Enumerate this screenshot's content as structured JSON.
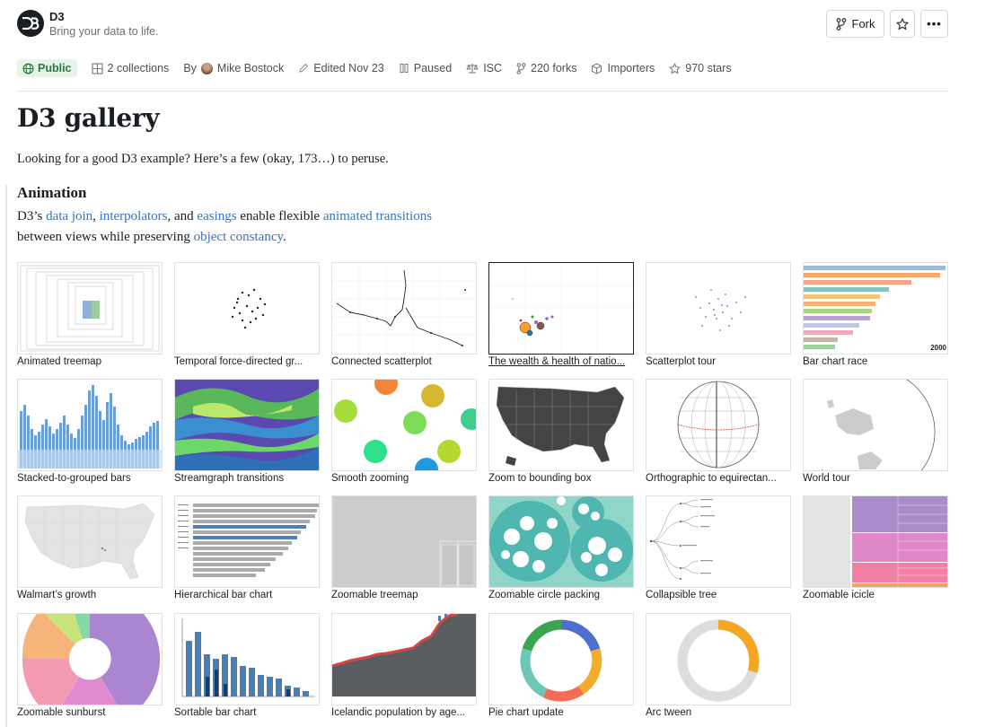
{
  "header": {
    "owner": "D3",
    "tagline": "Bring your data to life.",
    "fork_label": "Fork",
    "more_label": "•••"
  },
  "meta": {
    "visibility": "Public",
    "collections": "2 collections",
    "by_label": "By",
    "author": "Mike Bostock",
    "edited": "Edited Nov 23",
    "status": "Paused",
    "license": "ISC",
    "forks": "220 forks",
    "importers": "Importers",
    "stars": "970 stars"
  },
  "page": {
    "title": "D3 gallery",
    "intro": "Looking for a good D3 example? Here’s a few (okay, 173…) to peruse."
  },
  "section": {
    "heading": "Animation",
    "t1": "D3’s ",
    "l1": "data join",
    "t2": ", ",
    "l2": "interpolators",
    "t3": ", and ",
    "l3": "easings",
    "t4": " enable flexible ",
    "l4": "animated transitions",
    "t5": " between views while preserving ",
    "l5": "object constancy",
    "t6": "."
  },
  "cards": [
    "Animated treemap",
    "Temporal force-directed gr...",
    "Connected scatterplot",
    "The wealth & health of natio...",
    "Scatterplot tour",
    "Bar chart race",
    "Stacked-to-grouped bars",
    "Streamgraph transitions",
    "Smooth zooming",
    "Zoom to bounding box",
    "Orthographic to equirectan...",
    "World tour",
    "Walmart’s growth",
    "Hierarchical bar chart",
    "Zoomable treemap",
    "Zoomable circle packing",
    "Collapsible tree",
    "Zoomable icicle",
    "Zoomable sunburst",
    "Sortable bar chart",
    "Icelandic population by age...",
    "Pie chart update",
    "Arc tween"
  ],
  "thumb_labels": {
    "bar_race_year": "2000"
  },
  "colors": {
    "link": "#3b73b8",
    "public_bg": "#e6f4ea",
    "public_fg": "#237a3c"
  }
}
